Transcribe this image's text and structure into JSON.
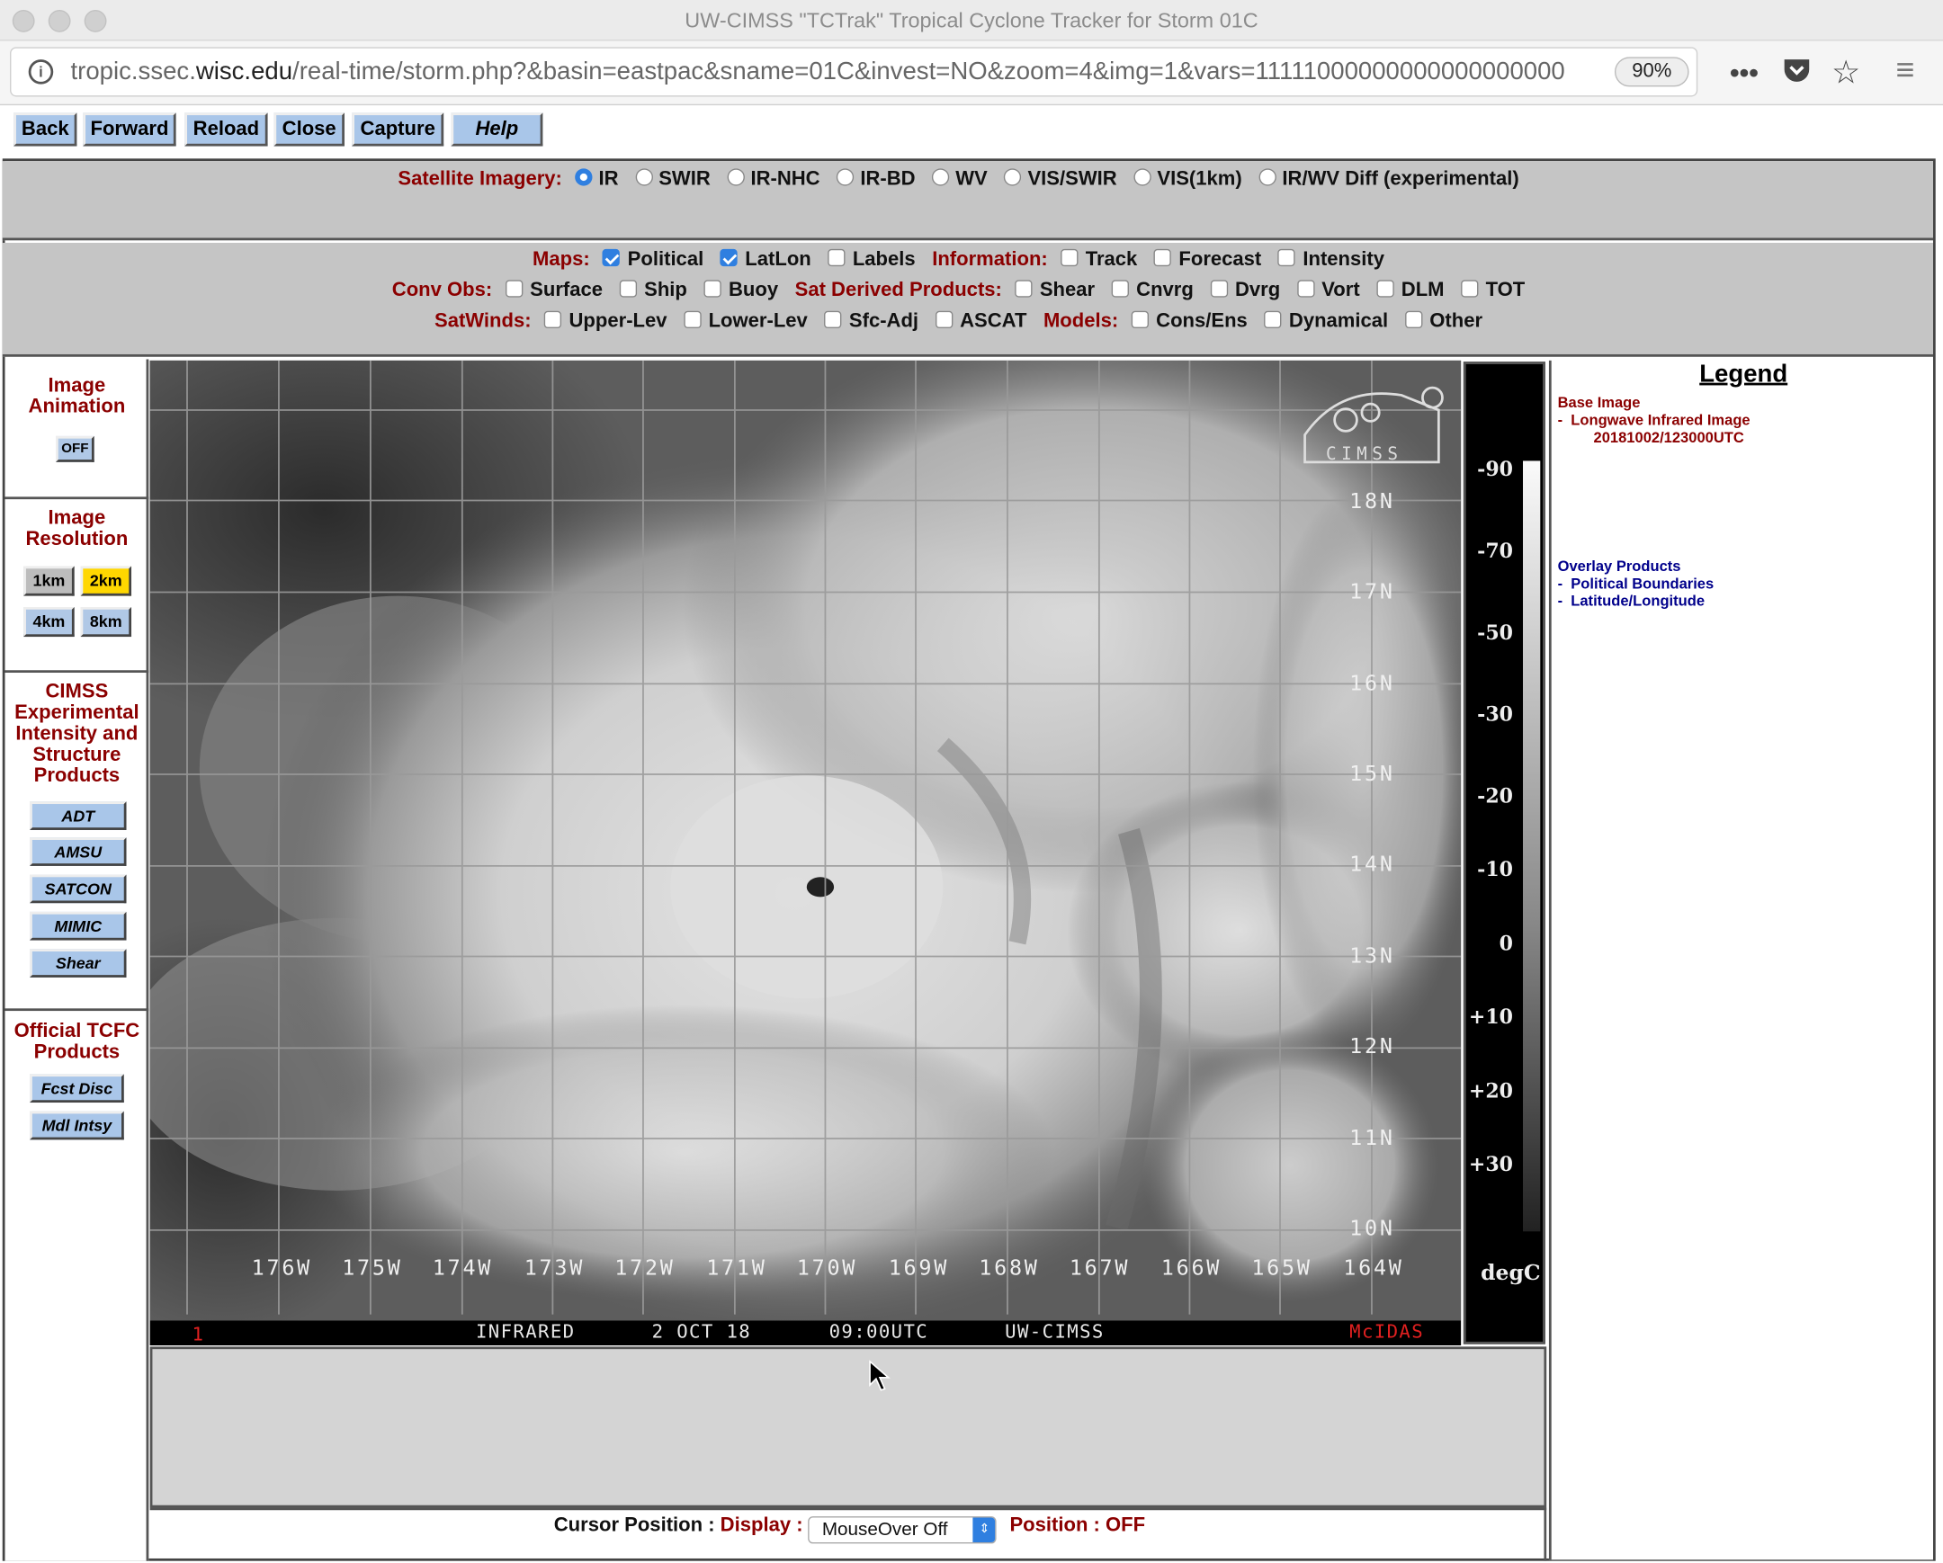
{
  "window": {
    "title": "UW-CIMSS \"TCTrak\" Tropical Cyclone Tracker for Storm 01C"
  },
  "browser": {
    "url_prefix": "tropic.ssec.",
    "url_domain": "wisc.edu",
    "url_rest": "/real-time/storm.php?&basin=eastpac&sname=01C&invest=NO&zoom=4&img=1&vars=11111000000000000000000",
    "zoom": "90%"
  },
  "toolbar": {
    "back": "Back",
    "forward": "Forward",
    "reload": "Reload",
    "close": "Close",
    "capture": "Capture",
    "help": "Help"
  },
  "imagery": {
    "label": "Satellite Imagery:",
    "options": [
      "IR",
      "SWIR",
      "IR-NHC",
      "IR-BD",
      "WV",
      "VIS/SWIR",
      "VIS(1km)",
      "IR/WV Diff (experimental)"
    ],
    "selected": "IR"
  },
  "overlays": {
    "maps_label": "Maps:",
    "maps": [
      {
        "label": "Political",
        "checked": true
      },
      {
        "label": "LatLon",
        "checked": true
      },
      {
        "label": "Labels",
        "checked": false
      }
    ],
    "info_label": "Information:",
    "info": [
      "Track",
      "Forecast",
      "Intensity"
    ],
    "conv_label": "Conv Obs:",
    "conv": [
      "Surface",
      "Ship",
      "Buoy"
    ],
    "sat_label": "Sat Derived Products:",
    "sat": [
      "Shear",
      "Cnvrg",
      "Dvrg",
      "Vort",
      "DLM",
      "TOT"
    ],
    "winds_label": "SatWinds:",
    "winds": [
      "Upper-Lev",
      "Lower-Lev",
      "Sfc-Adj",
      "ASCAT"
    ],
    "models_label": "Models:",
    "models": [
      "Cons/Ens",
      "Dynamical",
      "Other"
    ]
  },
  "sidebar": {
    "animation_title_1": "Image",
    "animation_title_2": "Animation",
    "animation_btn": "OFF",
    "resolution_title_1": "Image",
    "resolution_title_2": "Resolution",
    "res_1km": "1km",
    "res_2km": "2km",
    "res_4km": "4km",
    "res_8km": "8km",
    "cimss_title": [
      "CIMSS",
      "Experimental",
      "Intensity and",
      "Structure",
      "Products"
    ],
    "adt": "ADT",
    "amsu": "AMSU",
    "satcon": "SATCON",
    "mimic": "MIMIC",
    "shear": "Shear",
    "official_title_1": "Official TCFC",
    "official_title_2": "Products",
    "fcst_disc": "Fcst Disc",
    "mdl_intsy": "Mdl Intsy"
  },
  "image": {
    "lat_labels": [
      "18N",
      "17N",
      "16N",
      "15N",
      "14N",
      "13N",
      "12N",
      "11N",
      "10N"
    ],
    "lon_labels": [
      "176W",
      "175W",
      "174W",
      "173W",
      "172W",
      "171W",
      "170W",
      "169W",
      "168W",
      "167W",
      "166W",
      "165W",
      "164W"
    ],
    "frame_number": "1",
    "caption_type": "INFRARED",
    "caption_date": "2 OCT 18",
    "caption_time": "09:00UTC",
    "caption_source": "UW-CIMSS",
    "caption_software": "McIDAS",
    "logo": "CIMSS"
  },
  "colorbar": {
    "labels": [
      "-90",
      "-70",
      "-50",
      "-30",
      "-20",
      "-10",
      "0",
      "+10",
      "+20",
      "+30"
    ],
    "unit": "degC"
  },
  "legend": {
    "title": "Legend",
    "base_heading": "Base Image",
    "base_item": "-  Longwave Infrared Image",
    "base_time": "20181002/123000UTC",
    "overlay_heading": "Overlay Products",
    "overlay_items": [
      "-  Political Boundaries",
      "-  Latitude/Longitude"
    ]
  },
  "cursor": {
    "label": "Cursor Position :",
    "display_label": "Display :",
    "display_value": "MouseOver Off",
    "position_label": "Position :",
    "position_value": "OFF"
  },
  "colors": {
    "button_blue": "#a9c6e9",
    "label_red": "#8b0000",
    "legend_blue": "#00008b",
    "selected_yellow": "#ffd700"
  }
}
